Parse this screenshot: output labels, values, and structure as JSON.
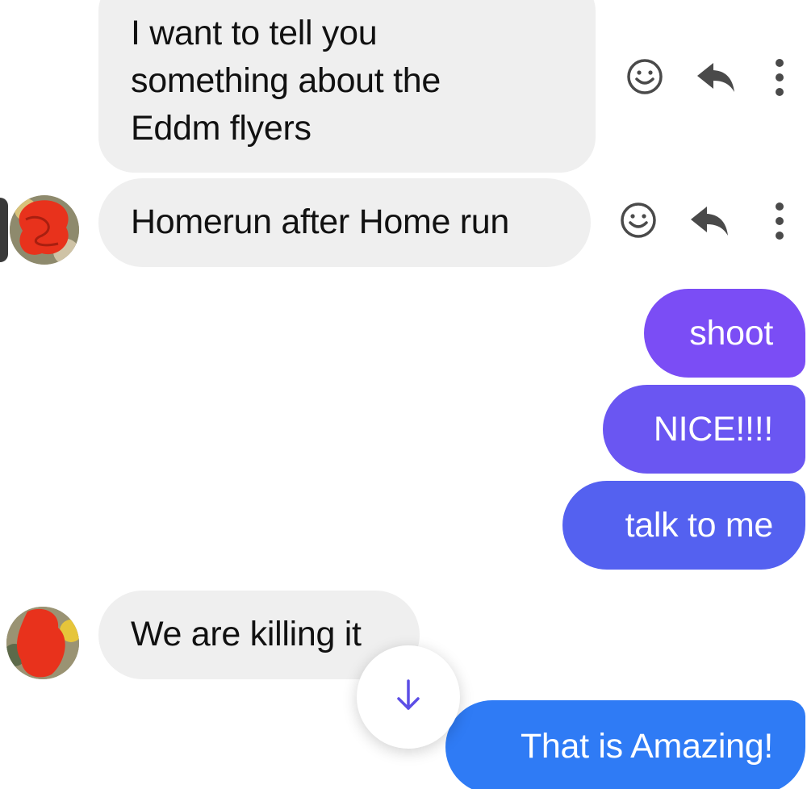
{
  "messages": {
    "m1": {
      "lines": [
        "I want to tell you",
        "something about the",
        "Eddm flyers"
      ],
      "direction": "incoming"
    },
    "m2": {
      "text": "Homerun after Home run",
      "direction": "incoming"
    },
    "m3": {
      "text": "shoot",
      "direction": "outgoing",
      "color": "#7b4df5"
    },
    "m4": {
      "text": "NICE!!!!",
      "direction": "outgoing",
      "color": "#6a56f2"
    },
    "m5": {
      "text": "talk to me",
      "direction": "outgoing",
      "color": "#5461f0"
    },
    "m6": {
      "text": "We are killing it",
      "direction": "incoming"
    },
    "m7": {
      "text": "That is Amazing!",
      "direction": "outgoing",
      "color": "#2f7bf5"
    }
  },
  "icons": {
    "react": "smiley-face-icon",
    "reply": "reply-arrow-icon",
    "more": "more-vertical-icon",
    "scroll": "arrow-down-icon"
  },
  "colors": {
    "incoming_bubble": "#efefef",
    "icon_gray": "#4a4a4a",
    "scroll_arrow": "#5c4ee6",
    "avatar_scribble": "#e8321c"
  }
}
